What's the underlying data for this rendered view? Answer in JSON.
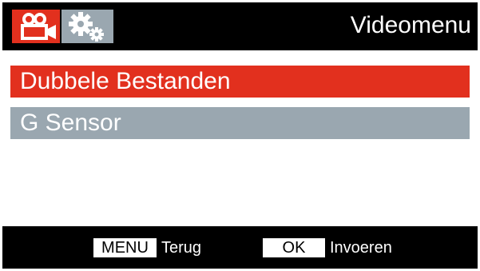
{
  "header": {
    "title": "Videomenu",
    "tabs": [
      {
        "icon": "video-camera-icon",
        "active": true,
        "color": "#e2301e"
      },
      {
        "icon": "settings-gears-icon",
        "active": false,
        "color": "#9aa7b0"
      }
    ]
  },
  "menu": {
    "items": [
      {
        "label": "Dubbele Bestanden",
        "selected": true,
        "color": "#e2301e"
      },
      {
        "label": "G Sensor",
        "selected": false,
        "color": "#9aa7b0"
      }
    ]
  },
  "footer": {
    "menu_key": "MENU",
    "menu_action": "Terug",
    "ok_key": "OK",
    "ok_action": "Invoeren"
  }
}
